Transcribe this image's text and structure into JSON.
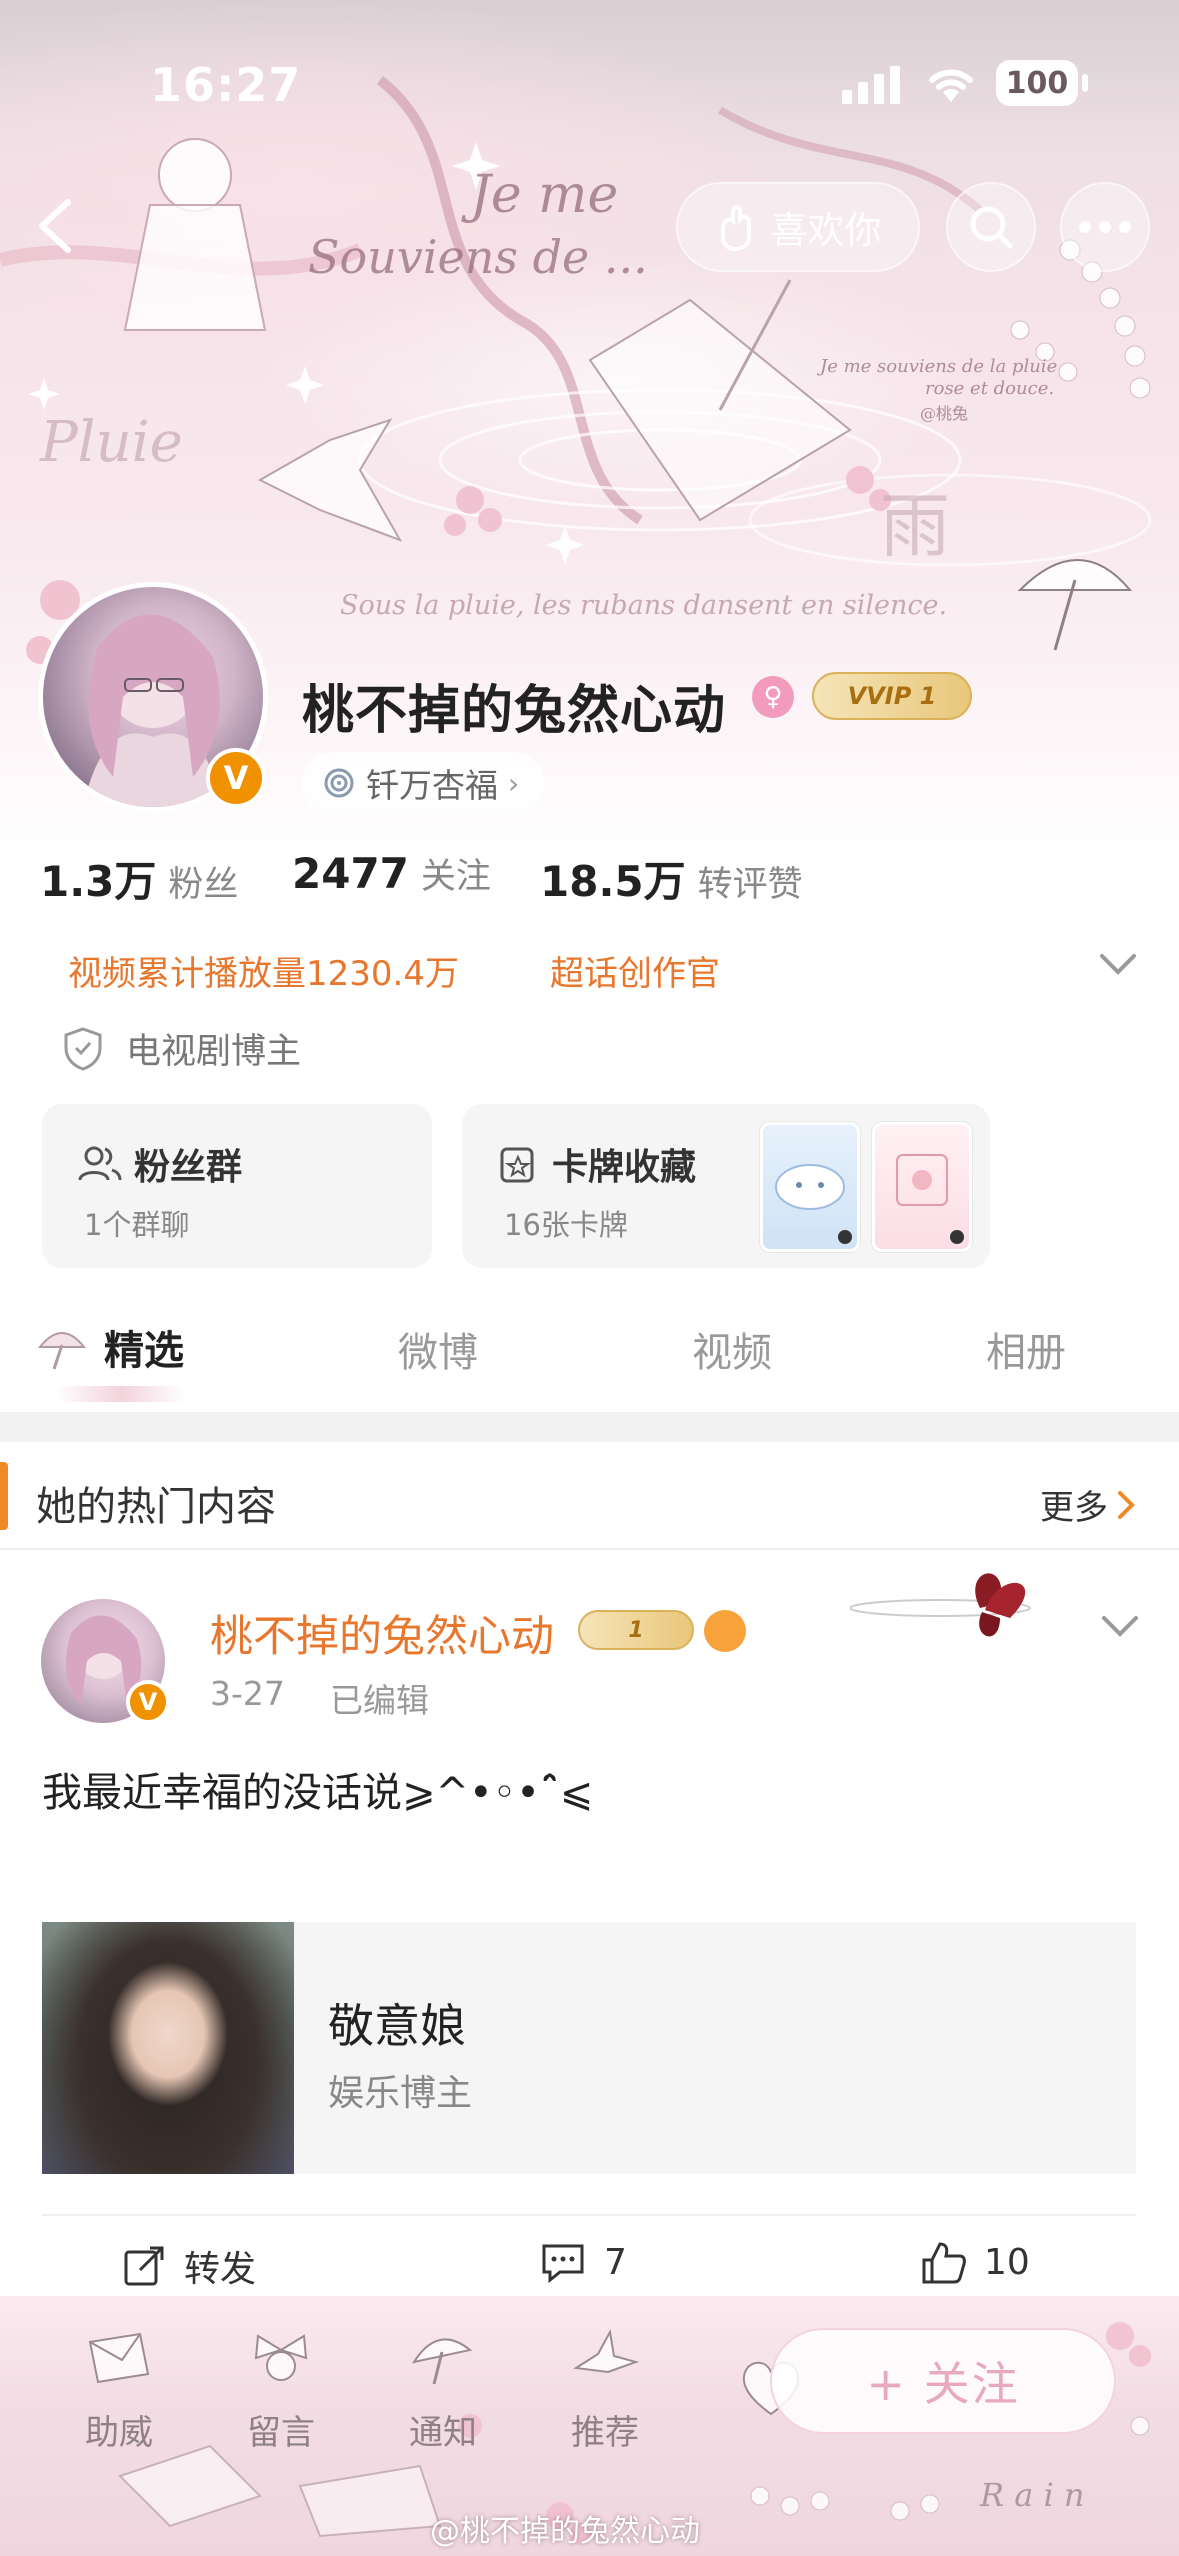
{
  "status_bar": {
    "time": "16:27",
    "battery": "100"
  },
  "header": {
    "like_label": "喜欢你",
    "icons": [
      "back-arrow-icon",
      "like-hand-icon",
      "search-icon",
      "more-icon"
    ]
  },
  "banner": {
    "deco_lines": [
      "Je me",
      "Souviens de ...",
      "Je me souviens de la pluie",
      "rose et douce.",
      "@桃兔",
      "Pluie",
      "雨",
      "Sous la pluie, les rubans dansent en silence."
    ]
  },
  "profile": {
    "name": "桃不掉的兔然心动",
    "gender": "female",
    "vip_label": "VVIP 1",
    "verified_badge": "V",
    "tag": "钎万杏福",
    "stats": [
      {
        "value": "1.3万",
        "label": "粉丝"
      },
      {
        "value": "2477",
        "label": "关注"
      },
      {
        "value": "18.5万",
        "label": "转评赞"
      }
    ],
    "highlights": [
      "视频累计播放量1230.4万",
      "超话创作官"
    ],
    "certification": "电视剧博主"
  },
  "cards": {
    "fan_group": {
      "title": "粉丝群",
      "subtitle": "1个群聊"
    },
    "card_collection": {
      "title": "卡牌收藏",
      "subtitle": "16张卡牌"
    }
  },
  "tabs": [
    "精选",
    "微博",
    "视频",
    "相册"
  ],
  "hot": {
    "title": "她的热门内容",
    "more": "更多"
  },
  "post": {
    "author": "桃不掉的兔然心动",
    "author_vip": "1",
    "date": "3-27",
    "edited": "已编辑",
    "text": "我最近幸福的没话说⩾^•◦•ˆ̑⩽",
    "shared_user": {
      "name": "敬意娘",
      "role": "娱乐博主"
    },
    "actions": {
      "repost": "转发",
      "comments": "7",
      "likes": "10"
    }
  },
  "bottom_nav": {
    "items": [
      "助威",
      "留言",
      "通知",
      "推荐"
    ],
    "follow": "+ 关注",
    "watermark": "@桃不掉的兔然心动"
  },
  "colors": {
    "accent_orange": "#e8772e",
    "verified_orange": "#f09100",
    "pink": "#f29bbd"
  }
}
